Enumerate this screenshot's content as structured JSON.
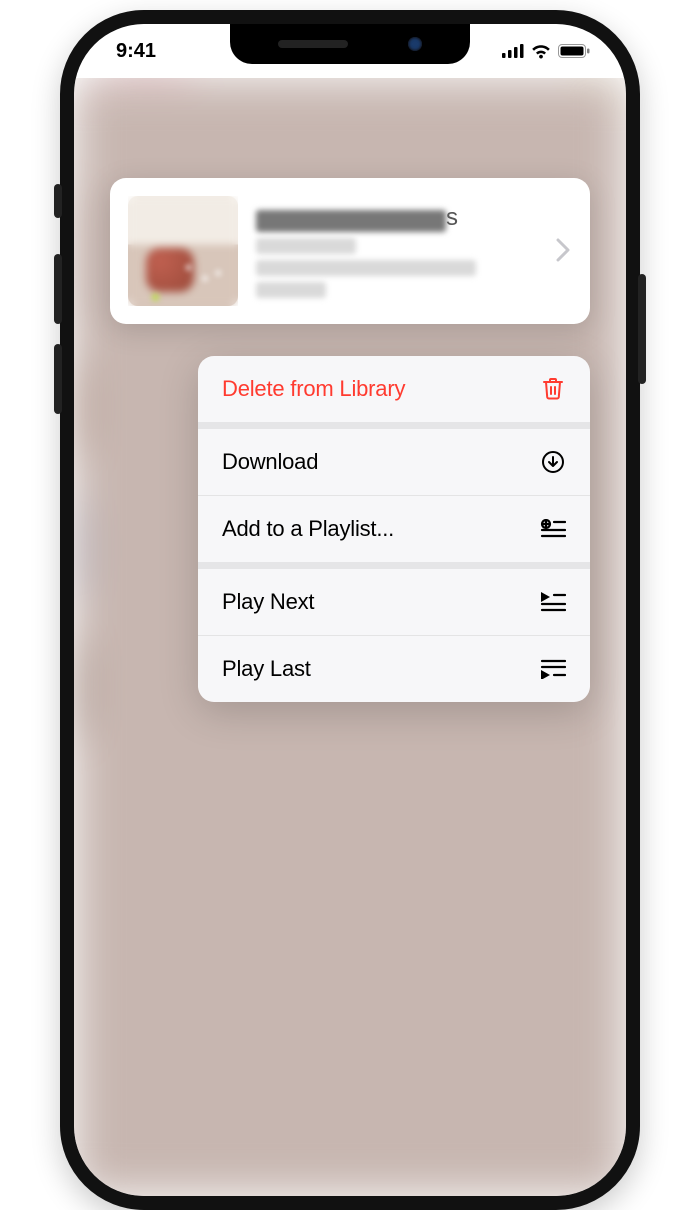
{
  "status": {
    "time": "9:41"
  },
  "track_card": {
    "title_visible_suffix": "s"
  },
  "menu": {
    "items": [
      {
        "label": "Delete from Library",
        "icon": "trash-icon",
        "destructive": true
      },
      {
        "label": "Download",
        "icon": "download-icon"
      },
      {
        "label": "Add to a Playlist...",
        "icon": "add-to-playlist-icon"
      },
      {
        "label": "Play Next",
        "icon": "play-next-icon"
      },
      {
        "label": "Play Last",
        "icon": "play-last-icon"
      }
    ]
  },
  "colors": {
    "destructive": "#ff3b30"
  }
}
